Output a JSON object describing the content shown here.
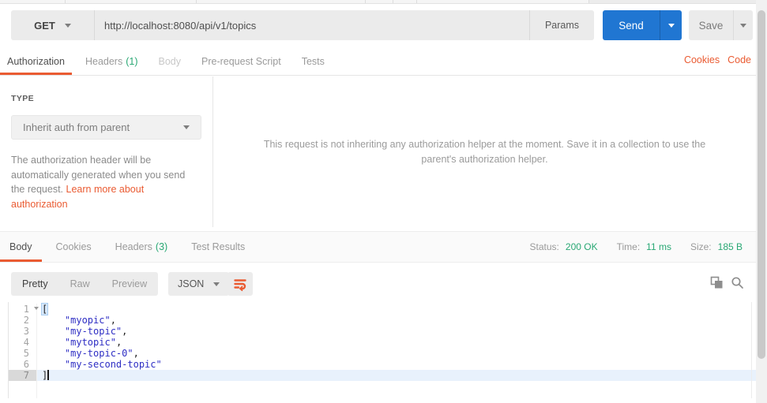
{
  "request_bar": {
    "method": "GET",
    "url": "http://localhost:8080/api/v1/topics",
    "params_label": "Params",
    "send_label": "Send",
    "save_label": "Save"
  },
  "request_tabs": {
    "authorization": "Authorization",
    "headers": "Headers",
    "headers_count": "(1)",
    "body": "Body",
    "pre_request": "Pre-request Script",
    "tests": "Tests",
    "cookies_link": "Cookies",
    "code_link": "Code"
  },
  "authorization": {
    "type_label": "TYPE",
    "type_value": "Inherit auth from parent",
    "description": "The authorization header will be automatically generated when you send the request. ",
    "learn_more_link": "Learn more about authorization",
    "helper_message": "This request is not inheriting any authorization helper at the moment. Save it in a collection to use the parent's authorization helper."
  },
  "response": {
    "tabs": {
      "body": "Body",
      "cookies": "Cookies",
      "headers": "Headers",
      "headers_count": "(3)",
      "test_results": "Test Results"
    },
    "status_label": "Status:",
    "status_value": "200 OK",
    "time_label": "Time:",
    "time_value": "11 ms",
    "size_label": "Size:",
    "size_value": "185 B",
    "view_pretty": "Pretty",
    "view_raw": "Raw",
    "view_preview": "Preview",
    "language": "JSON",
    "body_lines": [
      {
        "num": "1",
        "fold": true,
        "tokens": [
          {
            "t": "b",
            "v": "["
          }
        ]
      },
      {
        "num": "2",
        "tokens": [
          {
            "t": "p",
            "v": "    "
          },
          {
            "t": "s",
            "v": "\"myopic\""
          },
          {
            "t": "p",
            "v": ","
          }
        ]
      },
      {
        "num": "3",
        "tokens": [
          {
            "t": "p",
            "v": "    "
          },
          {
            "t": "s",
            "v": "\"my-topic\""
          },
          {
            "t": "p",
            "v": ","
          }
        ]
      },
      {
        "num": "4",
        "tokens": [
          {
            "t": "p",
            "v": "    "
          },
          {
            "t": "s",
            "v": "\"mytopic\""
          },
          {
            "t": "p",
            "v": ","
          }
        ]
      },
      {
        "num": "5",
        "tokens": [
          {
            "t": "p",
            "v": "    "
          },
          {
            "t": "s",
            "v": "\"my-topic-0\""
          },
          {
            "t": "p",
            "v": ","
          }
        ]
      },
      {
        "num": "6",
        "tokens": [
          {
            "t": "p",
            "v": "    "
          },
          {
            "t": "s",
            "v": "\"my-second-topic\""
          }
        ]
      },
      {
        "num": "7",
        "active": true,
        "cursor": true,
        "tokens": [
          {
            "t": "p",
            "v": "]"
          }
        ]
      }
    ]
  },
  "colors": {
    "accent_orange": "#ea5b32",
    "send_blue": "#2076d2",
    "status_green": "#29a874",
    "string_indigo": "#2e2ec4",
    "active_line_blue": "#e8f1fc"
  }
}
